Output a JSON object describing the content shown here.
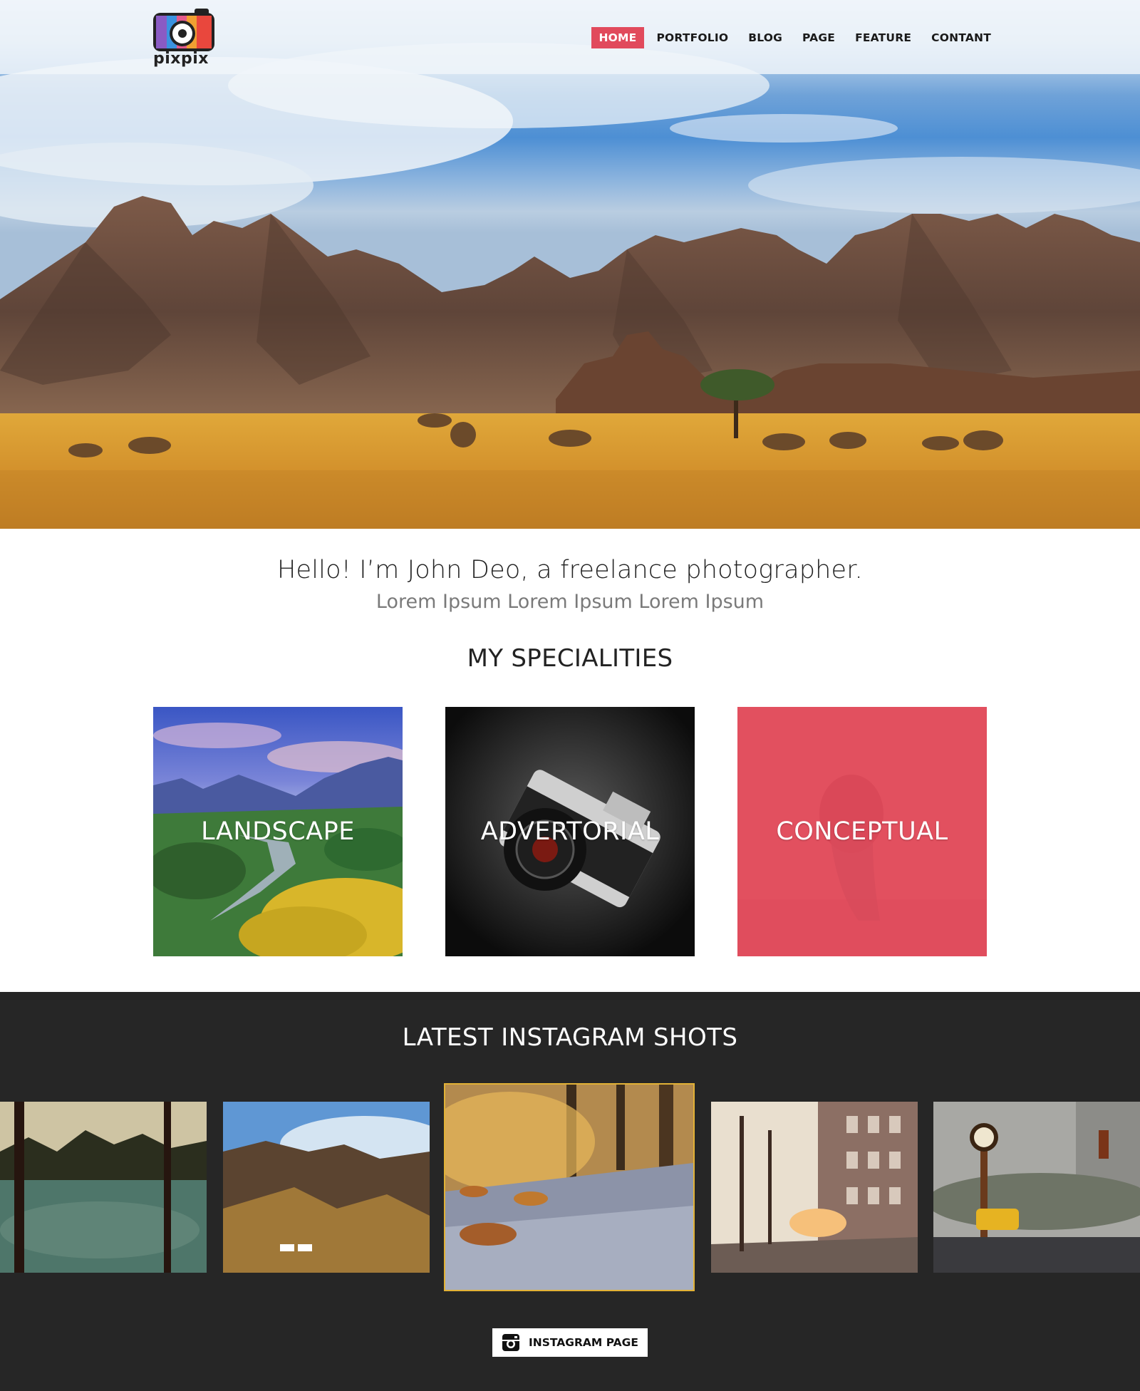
{
  "brand": {
    "logo_text": "pixpix"
  },
  "nav": {
    "items": [
      {
        "label": "HOME",
        "active": true
      },
      {
        "label": "PORTFOLIO",
        "active": false
      },
      {
        "label": "BLOG",
        "active": false
      },
      {
        "label": "PAGE",
        "active": false
      },
      {
        "label": "FEATURE",
        "active": false
      },
      {
        "label": "CONTANT",
        "active": false
      }
    ]
  },
  "intro": {
    "title": "Hello! I’m John Deo, a freelance photographer.",
    "subtitle": "Lorem Ipsum Lorem Ipsum Lorem Ipsum"
  },
  "specialities": {
    "heading": "MY SPECIALITIES",
    "cards": [
      {
        "label": "LANDSCAPE"
      },
      {
        "label": "ADVERTORIAL"
      },
      {
        "label": "CONCEPTUAL"
      }
    ]
  },
  "instagram": {
    "heading": "LATEST INSTAGRAM SHOTS",
    "button_label": "INSTAGRAM PAGE"
  },
  "colors": {
    "accent": "#e14a5c",
    "dark_band": "#262626",
    "highlight_border": "#e2b236"
  }
}
